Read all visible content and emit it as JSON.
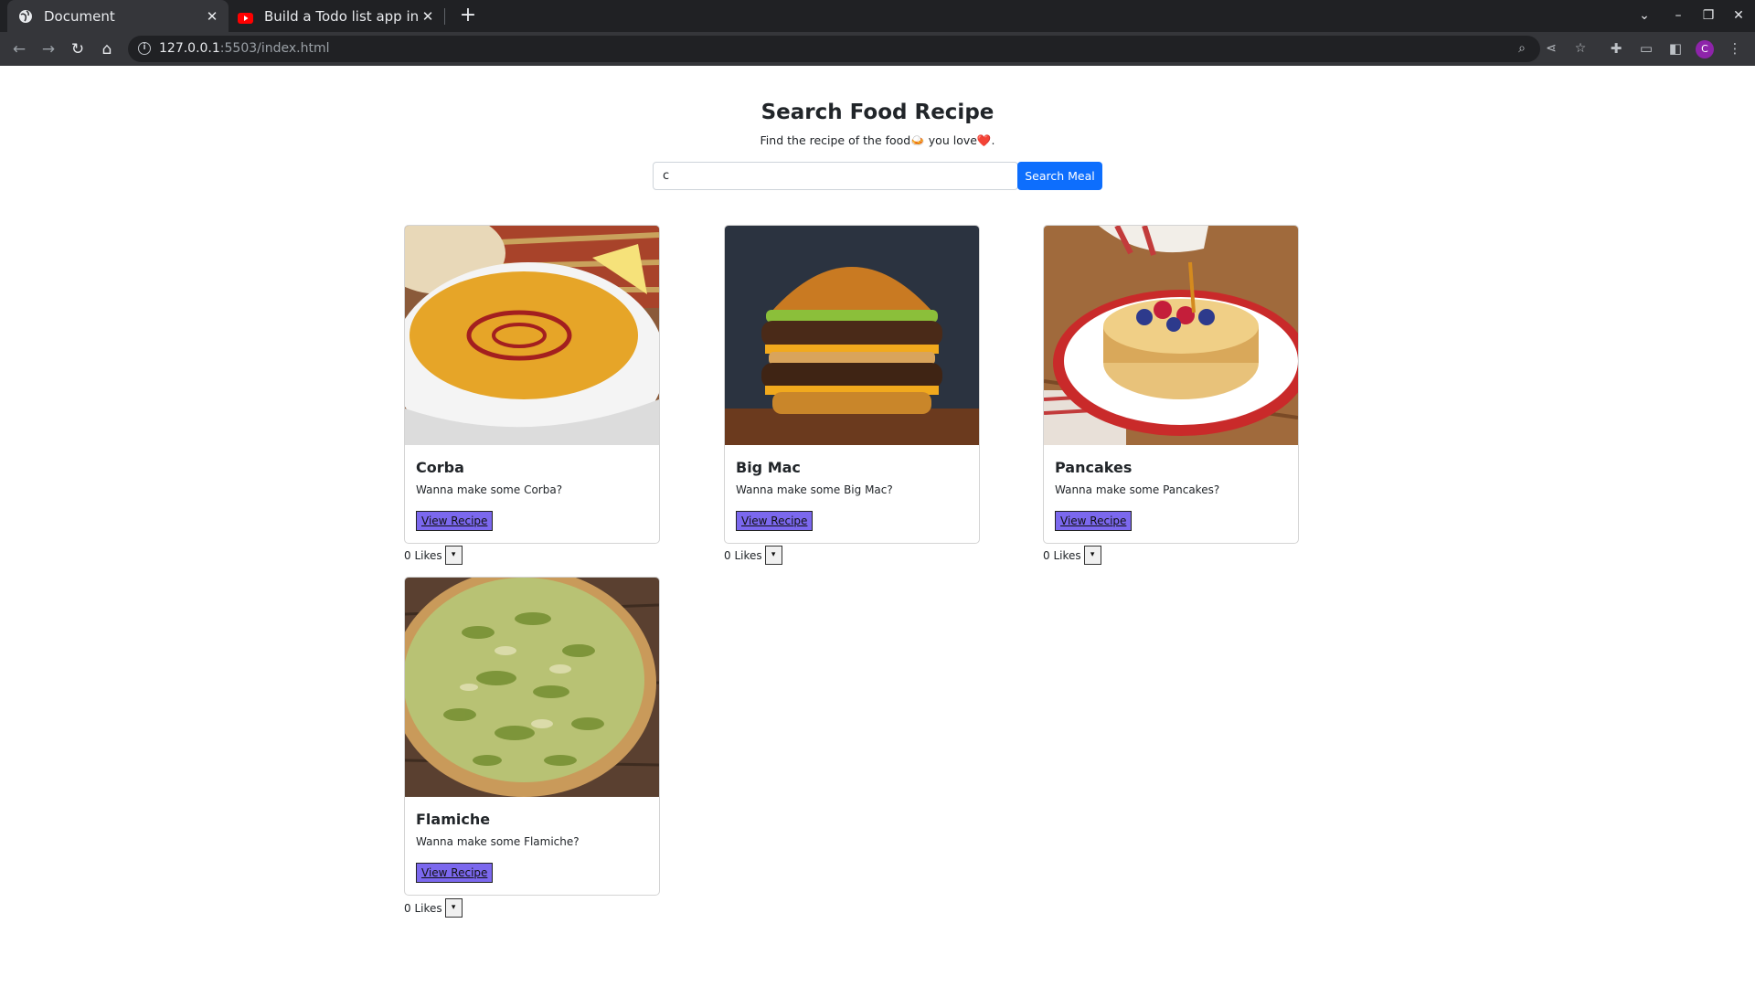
{
  "browser": {
    "tabs": [
      {
        "title": "Document",
        "active": true
      },
      {
        "title": "Build a Todo list app in HT",
        "active": false
      }
    ],
    "url_host": "127.0.0.1",
    "url_rest": ":5503/index.html",
    "profile_initial": "C"
  },
  "page": {
    "title": "Search Food Recipe",
    "subtitle": "Find the recipe of the food🍛 you love❤️.",
    "search": {
      "value": "c",
      "button_label": "Search Meal"
    }
  },
  "meals": [
    {
      "name": "Corba",
      "text": "Wanna make some Corba?",
      "button": "View Recipe",
      "likes": "0 Likes",
      "toggle": "▾"
    },
    {
      "name": "Big Mac",
      "text": "Wanna make some Big Mac?",
      "button": "View Recipe",
      "likes": "0 Likes",
      "toggle": "▾"
    },
    {
      "name": "Pancakes",
      "text": "Wanna make some Pancakes?",
      "button": "View Recipe",
      "likes": "0 Likes",
      "toggle": "▾"
    },
    {
      "name": "Flamiche",
      "text": "Wanna make some Flamiche?",
      "button": "View Recipe",
      "likes": "0 Likes",
      "toggle": "▾"
    }
  ],
  "colors": {
    "search_button": "#0d6efd",
    "recipe_button": "#7b68ee",
    "chrome_dark": "#202124",
    "chrome_toolbar": "#35363a"
  }
}
